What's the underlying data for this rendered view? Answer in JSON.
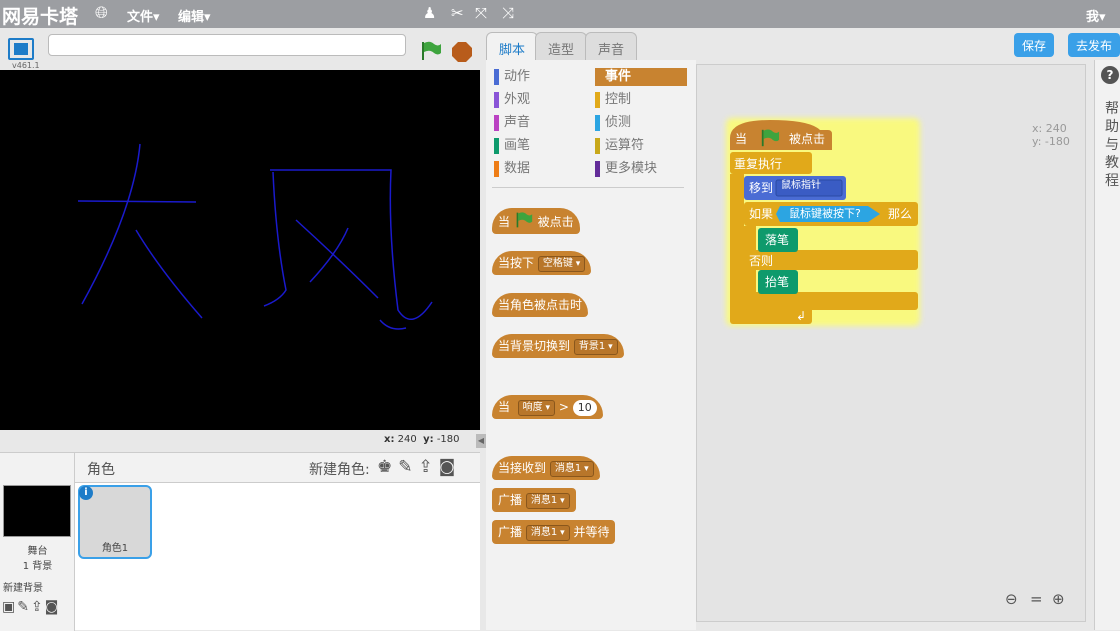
{
  "topbar": {
    "app_name": "网易卡塔",
    "menu_file": "文件▾",
    "menu_edit": "编辑▾",
    "user": "我▾"
  },
  "stage": {
    "version": "v461.1",
    "x_label": "x:",
    "x_value": "240",
    "y_label": "y:",
    "y_value": "-180"
  },
  "sprites": {
    "header_label": "角色",
    "new_sprite_label": "新建角色:",
    "stage_name": "舞台",
    "stage_bg_count": "1 背景",
    "new_bg_label": "新建背景",
    "sprite1_name": "角色1"
  },
  "tabs": [
    "脚本",
    "造型",
    "声音"
  ],
  "buttons": {
    "save": "保存",
    "share": "去发布"
  },
  "categories": [
    {
      "label": "动作",
      "color": "#4a6cd4"
    },
    {
      "label": "外观",
      "color": "#8a55d7"
    },
    {
      "label": "声音",
      "color": "#bb42c3"
    },
    {
      "label": "画笔",
      "color": "#0e9a6c"
    },
    {
      "label": "数据",
      "color": "#ee7d16"
    },
    {
      "label": "事件",
      "color": "#c88330"
    },
    {
      "label": "控制",
      "color": "#e1a91a"
    },
    {
      "label": "侦测",
      "color": "#2ca5e2"
    },
    {
      "label": "运算符",
      "color": "#5cb712"
    },
    {
      "label": "更多模块",
      "color": "#632d99"
    }
  ],
  "palette_blocks": {
    "when_flag_pre": "当",
    "when_flag_post": "被点击",
    "when_key": "当按下",
    "key_option": "空格键",
    "when_sprite_clicked": "当角色被点击时",
    "when_bg": "当背景切换到",
    "bg_option": "背景1",
    "when_sensor": "当",
    "sensor_option": "响度",
    "sensor_op": ">",
    "sensor_value": "10",
    "when_receive": "当接收到",
    "msg_option": "消息1",
    "broadcast": "广播",
    "broadcast_wait_post": "并等待"
  },
  "script": {
    "hat_pre": "当",
    "hat_post": "被点击",
    "forever": "重复执行",
    "goto": "移到",
    "goto_option": "鼠标指针",
    "if": "如果",
    "condition": "鼠标键被按下?",
    "then": "那么",
    "pen_down": "落笔",
    "else": "否则",
    "pen_up": "抬笔",
    "x_label": "x:",
    "x_value": "240",
    "y_label": "y:",
    "y_value": "-180"
  },
  "help": {
    "text": "帮助与教程"
  },
  "drawing": {
    "stroke_color": "#1a1acc"
  }
}
